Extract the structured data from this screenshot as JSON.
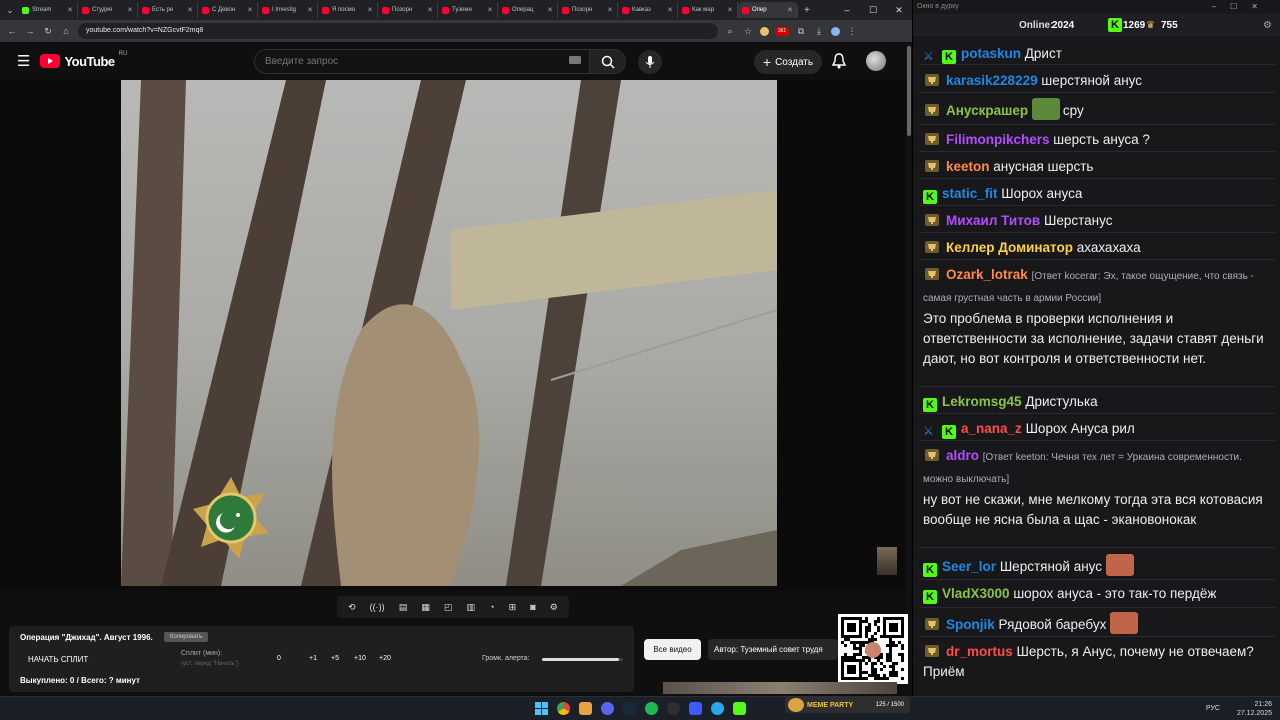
{
  "browser": {
    "tabs": [
      {
        "label": "Stream",
        "color": "#53fc18"
      },
      {
        "label": "Студия",
        "color": "#ff0033"
      },
      {
        "label": "Есть ре",
        "color": "#ff0033"
      },
      {
        "label": "С Девон",
        "color": "#ff0033"
      },
      {
        "label": "I Investig",
        "color": "#ff0033"
      },
      {
        "label": "Я посмо",
        "color": "#ff0033"
      },
      {
        "label": "Позорн",
        "color": "#ff0033"
      },
      {
        "label": "Туземн",
        "color": "#ff0033"
      },
      {
        "label": "Операц",
        "color": "#ff0033"
      },
      {
        "label": "Позорн",
        "color": "#ff0033"
      },
      {
        "label": "Кавказ",
        "color": "#ff0033"
      },
      {
        "label": "Как мар",
        "color": "#ff0033"
      },
      {
        "label": "Опер",
        "color": "#ff0033"
      }
    ],
    "new_tab": "+",
    "url": "youtube.com/watch?v=NZGcvtF2mq8",
    "ext_badge": "361"
  },
  "youtube": {
    "logo_text": "YouTube",
    "logo_region": "RU",
    "search_placeholder": "Введите запрос",
    "create_label": "Создать"
  },
  "split_panel": {
    "title": "Операция \"Джихад\". Август 1996.",
    "copy_label": "Копировать",
    "start_label": "НАЧАТЬ СПЛИТ",
    "split_label": "Сплит (мин):",
    "split_hint": "(уст. перед \"Начать\")",
    "split_values": [
      "0",
      "+1",
      "+5",
      "+10",
      "+20"
    ],
    "volume_label": "Громк. алерта:",
    "volume_level": 0.95,
    "bought": "Выкуплено: 0 / Всего: ? минут"
  },
  "all_videos_label": "Все видео",
  "author_label": "Автор: Туземный совет трудя",
  "meme_party": {
    "label": "MEME PARTY",
    "counter": "125 / 1500"
  },
  "tray": {
    "lang": "РУС",
    "time": "21:26",
    "date": "27.12.2025"
  },
  "chat": {
    "window_title": "Окно в дурку",
    "online_label": "Online:",
    "online_count": "2024",
    "k_count": "1269",
    "trophy_count": "755",
    "messages": [
      {
        "nick": "potaskun",
        "nick_color": "#1e88e5",
        "badges": [
          "sword",
          "k"
        ],
        "text": "Дрист"
      },
      {
        "nick": "karasik228229",
        "nick_color": "#1e88e5",
        "badges": [
          "trophy"
        ],
        "text": "шерстяной анус"
      },
      {
        "nick": "Анускрашер",
        "nick_color": "#8bc34a",
        "badges": [
          "trophy"
        ],
        "text": "сру",
        "emote": "#5d8a3a"
      },
      {
        "nick": "Filimonpikchers",
        "nick_color": "#b44cff",
        "badges": [
          "trophy"
        ],
        "text": "шерсть ануса ?"
      },
      {
        "nick": "keeton",
        "nick_color": "#ff8a4c",
        "badges": [
          "trophy"
        ],
        "text": "анусная шерсть"
      },
      {
        "nick": "static_fit",
        "nick_color": "#1e88e5",
        "badges": [
          "k"
        ],
        "text": "Шорох ануса"
      },
      {
        "nick": "Михаил Титов",
        "nick_color": "#b44cff",
        "badges": [
          "trophy"
        ],
        "text": "Шерстанус"
      },
      {
        "nick": "Келлер Доминатор",
        "nick_color": "#ffd23f",
        "badges": [
          "trophy"
        ],
        "text": "ахахахаха"
      },
      {
        "nick": "Ozark_lotrak",
        "nick_color": "#ff8a4c",
        "badges": [
          "trophy"
        ],
        "reply": "[Ответ kocerar: Эх, такое ощущение, что связь - самая грустная часть в армии России]",
        "text": "Это проблема в проверки исполнения и ответственности за исполнение,  задачи ставят деньги дают, но вот контроля и ответственности нет."
      },
      {
        "nick": "Lekromsg45",
        "nick_color": "#8bc34a",
        "badges": [
          "k"
        ],
        "text": "Дристулька"
      },
      {
        "nick": "a_nana_z",
        "nick_color": "#ff4c4c",
        "badges": [
          "sword",
          "k"
        ],
        "text": "Шорох Ануса рил"
      },
      {
        "nick": "aldro",
        "nick_color": "#b44cff",
        "badges": [
          "trophy"
        ],
        "reply": "[Ответ keeton: Чечня тех лет = Уркаина современности. можно выключать]",
        "text": "ну вот не скажи, мне мелкому тогда эта вся котовасия вообще не ясна была а щас - экановонокак"
      },
      {
        "nick": "Seer_lor",
        "nick_color": "#1e88e5",
        "badges": [
          "k"
        ],
        "text": "Шерстяной анус",
        "emote": "#c0644a"
      },
      {
        "nick": "VladX3000",
        "nick_color": "#8bc34a",
        "badges": [
          "k"
        ],
        "text": "шорох ануса - это так-то пердёж"
      },
      {
        "nick": "Sponjik",
        "nick_color": "#1e88e5",
        "badges": [
          "trophy"
        ],
        "text": "Рядовой баребух",
        "emote": "#c0644a"
      },
      {
        "nick": "dr_mortus",
        "nick_color": "#ff4c4c",
        "badges": [
          "trophy"
        ],
        "text": "Шерсть, я Анус, почему не отвечаем? Приём"
      }
    ]
  }
}
